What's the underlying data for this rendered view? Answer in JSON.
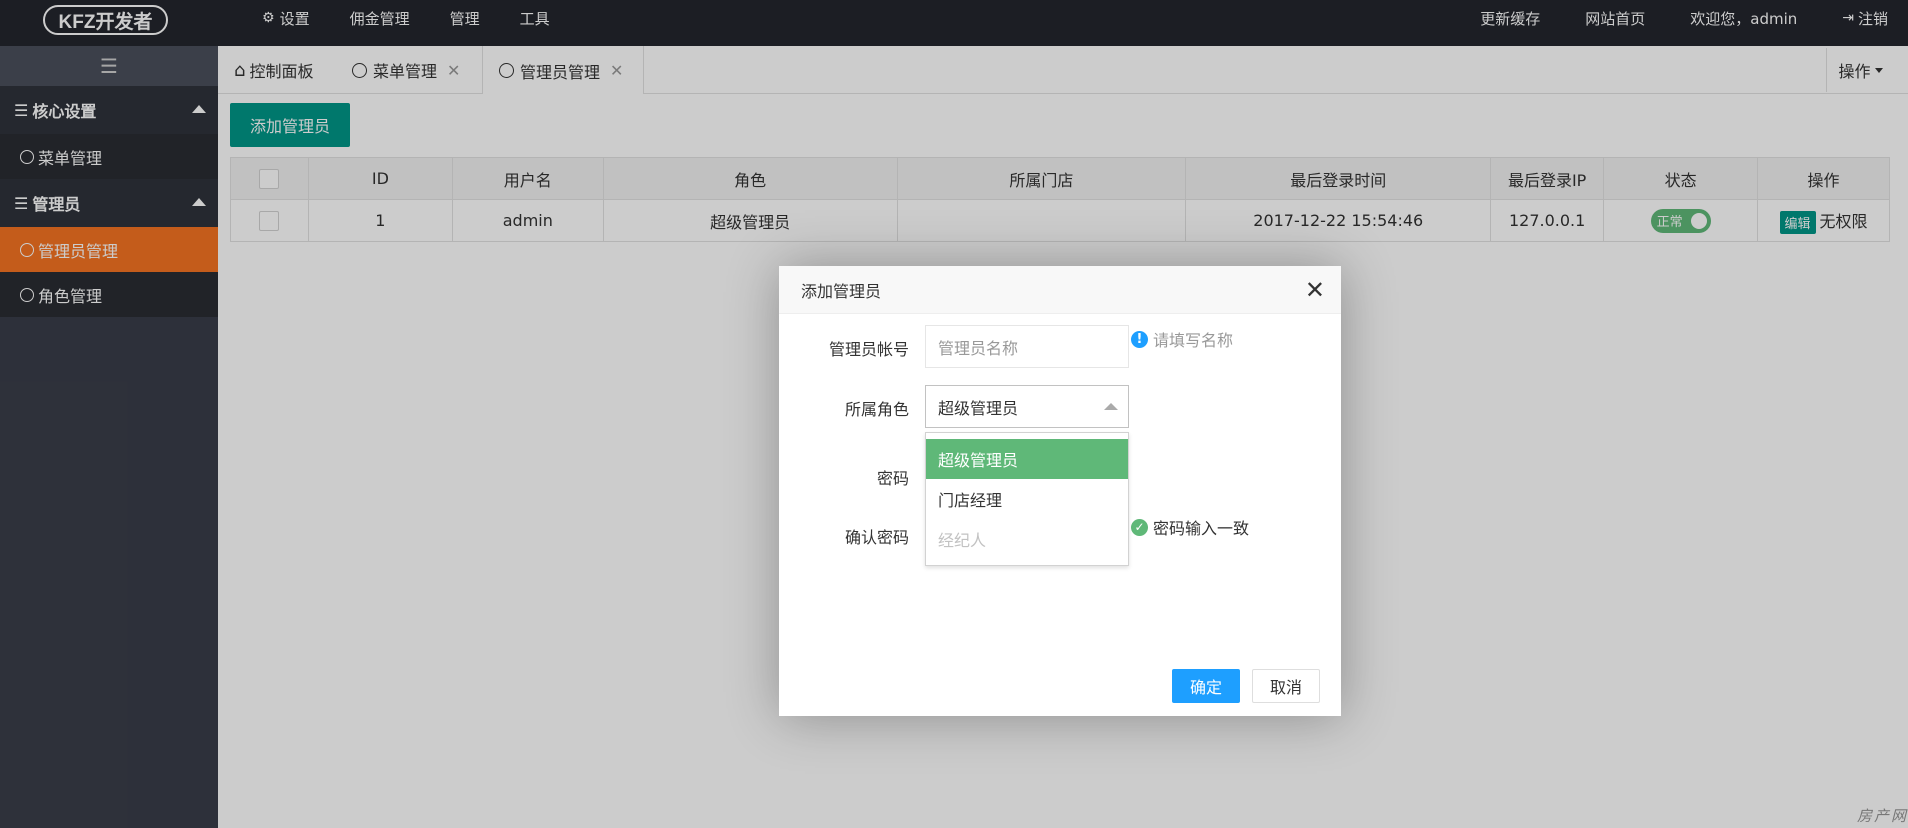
{
  "header": {
    "logo_text": "KFZ开发者",
    "nav": [
      {
        "label": "设置",
        "icon": "gears-icon"
      },
      {
        "label": "佣金管理"
      },
      {
        "label": "管理"
      },
      {
        "label": "工具"
      }
    ],
    "right": {
      "refresh_cache": "更新缓存",
      "site_home": "网站首页",
      "welcome": "欢迎您，admin",
      "logout": "注销"
    }
  },
  "sidebar": {
    "toggle_icon": "☰",
    "groups": [
      {
        "label": "核心设置",
        "items": [
          {
            "label": "菜单管理",
            "active": false
          }
        ]
      },
      {
        "label": "管理员",
        "items": [
          {
            "label": "管理员管理",
            "active": true
          },
          {
            "label": "角色管理",
            "active": false
          }
        ]
      }
    ]
  },
  "tabs": {
    "items": [
      {
        "label": "控制面板",
        "icon": "home-icon"
      },
      {
        "label": "菜单管理",
        "icon": "circle-icon",
        "closable": true
      },
      {
        "label": "管理员管理",
        "icon": "circle-icon",
        "closable": true,
        "active": true
      }
    ],
    "ops_label": "操作"
  },
  "main": {
    "add_button": "添加管理员",
    "table": {
      "columns": [
        "",
        "ID",
        "用户名",
        "角色",
        "所属门店",
        "最后登录时间",
        "最后登录IP",
        "状态",
        "操作"
      ],
      "rows": [
        {
          "id": "1",
          "username": "admin",
          "role": "超级管理员",
          "store": "",
          "last_login": "2017-12-22 15:54:46",
          "ip": "127.0.0.1",
          "status": "正常",
          "edit": "编辑",
          "no_perm": "无权限"
        }
      ]
    }
  },
  "dialog": {
    "title": "添加管理员",
    "fields": {
      "account_label": "管理员帐号",
      "account_placeholder": "管理员名称",
      "account_hint": "请填写名称",
      "role_label": "所属角色",
      "role_value": "超级管理员",
      "password_label": "密码",
      "confirm_label": "确认密码",
      "confirm_hint": "密码输入一致"
    },
    "role_options": [
      {
        "label": "超级管理员",
        "selected": true
      },
      {
        "label": "门店经理"
      },
      {
        "label": "经纪人",
        "disabled": true
      }
    ],
    "ok": "确定",
    "cancel": "取消"
  },
  "watermark": "房产网",
  "colors": {
    "header_bg": "#23262e",
    "sidebar_bg": "#393d49",
    "active_orange": "#f57322",
    "teal": "#009688",
    "green": "#5fb878",
    "blue": "#1e9fff"
  }
}
